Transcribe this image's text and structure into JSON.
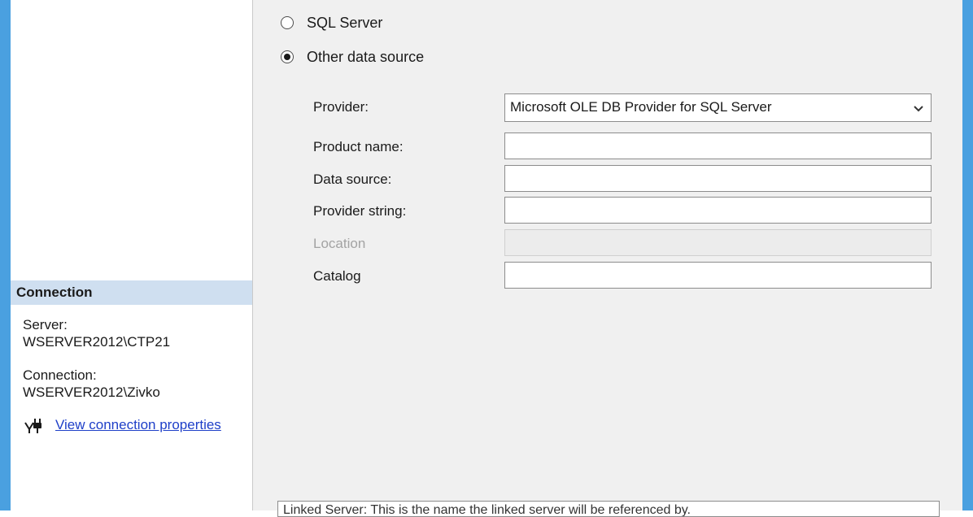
{
  "colors": {
    "window_frame": "#4aa0e0",
    "section_header": "#cfdff0",
    "link": "#1e3fc8",
    "dialog_background": "#f0f0f0",
    "disabled_text": "#a3a3a3"
  },
  "server_type": {
    "options": [
      {
        "label": "SQL Server",
        "selected": false
      },
      {
        "label": "Other data source",
        "selected": true
      }
    ]
  },
  "form": {
    "provider": {
      "label": "Provider:",
      "value": "Microsoft OLE DB Provider for SQL Server",
      "icon": "chevron-down-icon"
    },
    "product_name": {
      "label": "Product name:",
      "value": ""
    },
    "data_source": {
      "label": "Data source:",
      "value": ""
    },
    "provider_string": {
      "label": "Provider string:",
      "value": ""
    },
    "location": {
      "label": "Location",
      "value": "",
      "disabled": true
    },
    "catalog": {
      "label": "Catalog",
      "value": ""
    }
  },
  "description": {
    "text": "Linked Server: This is the name the linked server will be referenced by."
  },
  "connection": {
    "header": "Connection",
    "server_label": "Server:",
    "server_value": "WSERVER2012\\CTP21",
    "connection_label": "Connection:",
    "connection_value": "WSERVER2012\\Zivko",
    "link_icon": "plug-icon",
    "link_text": "View connection properties"
  }
}
